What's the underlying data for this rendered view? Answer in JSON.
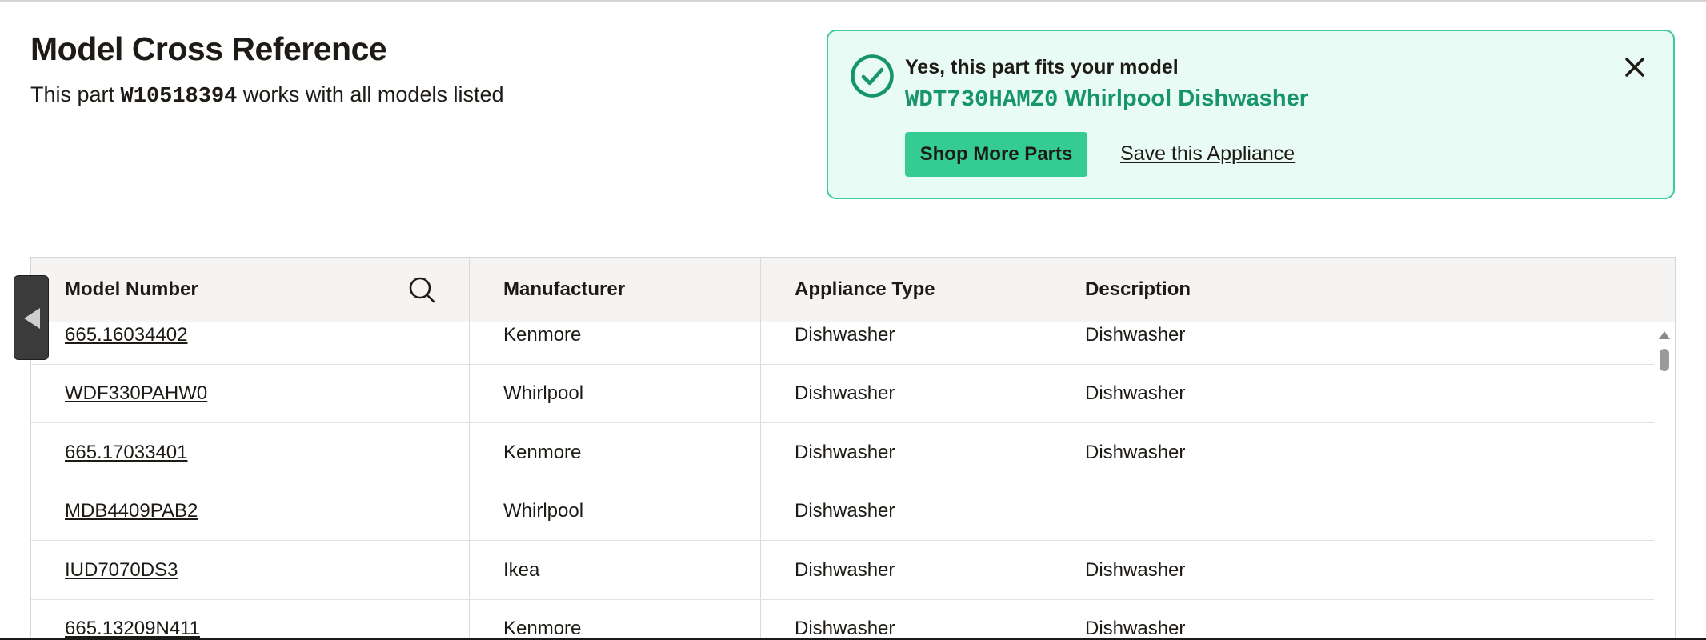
{
  "header": {
    "title": "Model Cross Reference",
    "subtitle_pre": "This part ",
    "part_number": "W10518394",
    "subtitle_post": " works with all models listed"
  },
  "fit_panel": {
    "heading": "Yes, this part fits your model",
    "model_number": "WDT730HAMZ0",
    "model_description": "Whirlpool Dishwasher",
    "shop_button_label": "Shop More Parts",
    "save_link_label": "Save this Appliance",
    "accent_color": "#16946a",
    "background_color": "#e8fbf4",
    "icons": {
      "status": "check-circle-icon",
      "close": "close-icon"
    }
  },
  "table": {
    "columns": [
      "Model Number",
      "Manufacturer",
      "Appliance Type",
      "Description"
    ],
    "search_icon": "search-icon",
    "rows": [
      {
        "model": "665.16034402",
        "manufacturer": "Kenmore",
        "type": "Dishwasher",
        "description": "Dishwasher"
      },
      {
        "model": "WDF330PAHW0",
        "manufacturer": "Whirlpool",
        "type": "Dishwasher",
        "description": "Dishwasher"
      },
      {
        "model": "665.17033401",
        "manufacturer": "Kenmore",
        "type": "Dishwasher",
        "description": "Dishwasher"
      },
      {
        "model": "MDB4409PAB2",
        "manufacturer": "Whirlpool",
        "type": "Dishwasher",
        "description": ""
      },
      {
        "model": "IUD7070DS3",
        "manufacturer": "Ikea",
        "type": "Dishwasher",
        "description": "Dishwasher"
      },
      {
        "model": "665.13209N411",
        "manufacturer": "Kenmore",
        "type": "Dishwasher",
        "description": "Dishwasher"
      }
    ]
  },
  "side_toggle": {
    "icon": "chevron-left-icon"
  }
}
